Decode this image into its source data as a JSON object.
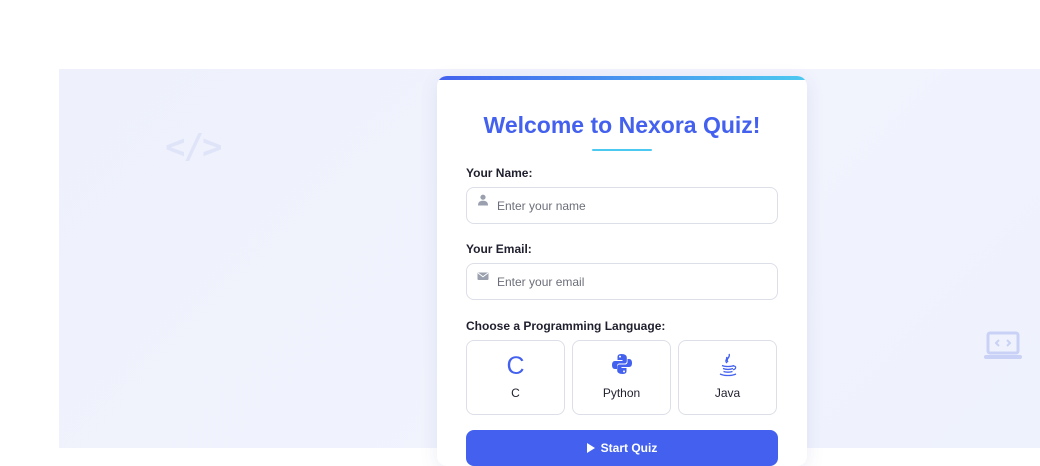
{
  "decor": {
    "code_symbol": "</>",
    "laptop_icon": "laptop-code-icon"
  },
  "card": {
    "title": "Welcome to Nexora Quiz!",
    "name_label": "Your Name:",
    "name_placeholder": "Enter your name",
    "name_icon": "user-icon",
    "email_label": "Your Email:",
    "email_placeholder": "Enter your email",
    "email_icon": "envelope-icon",
    "language_label": "Choose a Programming Language:",
    "languages": [
      {
        "name": "C",
        "icon": "c-icon",
        "glyph": "C"
      },
      {
        "name": "Python",
        "icon": "python-icon"
      },
      {
        "name": "Java",
        "icon": "java-icon"
      }
    ],
    "start_button": "Start Quiz",
    "start_icon": "play-icon"
  },
  "colors": {
    "primary": "#4361ee",
    "accent": "#4cc9f0",
    "background": "#eef1fc"
  }
}
